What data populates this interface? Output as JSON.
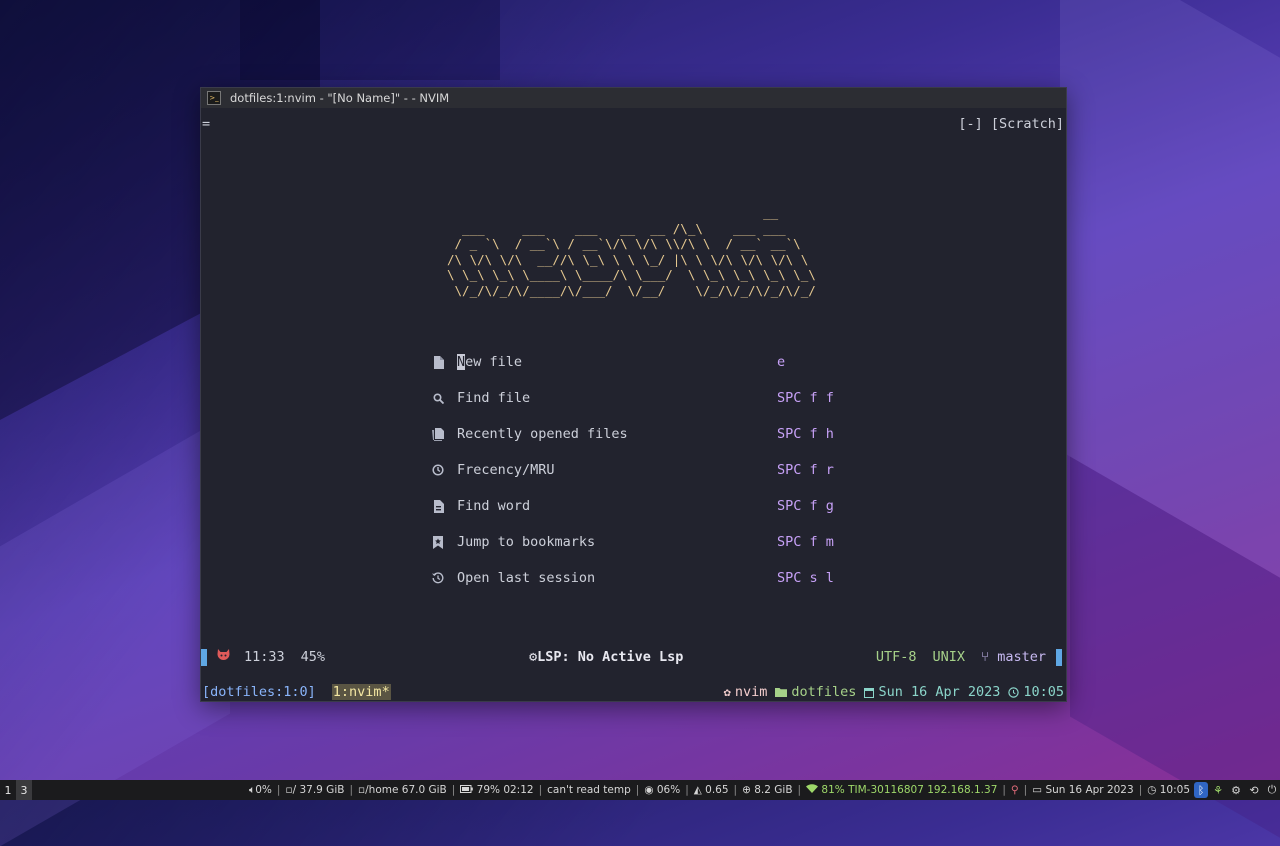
{
  "window": {
    "title": "dotfiles:1:nvim - \"[No Name]\" - - NVIM"
  },
  "tabline": {
    "left": "=",
    "right": "[-] [Scratch]"
  },
  "dashboard": {
    "ascii_art": "                                          __\n  ___     ___    ___   __  __ /\\_\\    ___ ___\n / _ `\\  / __`\\ / __`\\/\\ \\/\\ \\\\/\\ \\  / __` __`\\\n/\\ \\/\\ \\/\\  __//\\ \\_\\ \\ \\ \\_/ |\\ \\ \\/\\ \\/\\ \\/\\ \\\n\\ \\_\\ \\_\\ \\____\\ \\____/\\ \\___/  \\ \\_\\ \\_\\ \\_\\ \\_\\\n \\/_/\\/_/\\/____/\\/___/  \\/__/    \\/_/\\/_/\\/_/\\/_/",
    "items": [
      {
        "icon": "file-icon",
        "cursor": "N",
        "label": "ew file",
        "shortcut": "e"
      },
      {
        "icon": "search-icon",
        "label": "Find file",
        "shortcut": "SPC f f"
      },
      {
        "icon": "recent-files-icon",
        "label": "Recently opened files",
        "shortcut": "SPC f h"
      },
      {
        "icon": "frecency-icon",
        "label": "Frecency/MRU",
        "shortcut": "SPC f r"
      },
      {
        "icon": "find-word-icon",
        "label": "Find word",
        "shortcut": "SPC f g"
      },
      {
        "icon": "bookmark-icon",
        "label": "Jump to bookmarks",
        "shortcut": "SPC f m"
      },
      {
        "icon": "history-icon",
        "label": "Open last session",
        "shortcut": "SPC s l"
      }
    ]
  },
  "statusline": {
    "position": "11:33",
    "percent": "45%",
    "lsp": "LSP: No Active Lsp",
    "encoding": "UTF-8",
    "fileformat": "UNIX",
    "branch": "master"
  },
  "tmux": {
    "session": "[dotfiles:1:0]",
    "window": "1:nvim*",
    "process": "nvim",
    "directory": "dotfiles",
    "date": "Sun 16 Apr 2023",
    "time": "10:05"
  },
  "taskbar": {
    "workspaces": [
      "1",
      "3"
    ],
    "volume": "0%",
    "root_disk": "/ 37.9 GiB",
    "home_disk": "/home 67.0 GiB",
    "battery": "79% 02:12",
    "temp": "can't read temp",
    "cpu": "06%",
    "load": "0.65",
    "memory": "8.2 GiB",
    "wifi": "81% TIM-30116807 192.168.1.37",
    "date": "Sun 16 Apr 2023",
    "time": "10:05"
  }
}
